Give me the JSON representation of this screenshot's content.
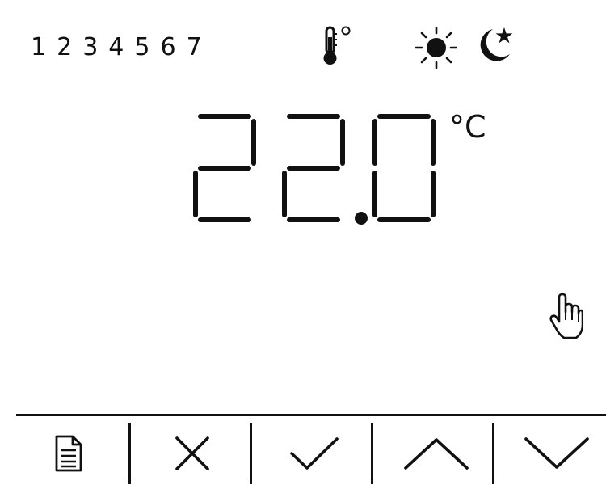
{
  "days": [
    "1",
    "2",
    "3",
    "4",
    "5",
    "6",
    "7"
  ],
  "status_icons": {
    "thermometer": "thermometer-icon",
    "day_mode": "sun-icon",
    "night_mode": "moon-star-icon"
  },
  "temperature": {
    "value": "22.0",
    "unit": "°C"
  },
  "pointer": "hand-pointer-icon",
  "toolbar": {
    "buttons": [
      {
        "icon": "document-icon",
        "name": "menu"
      },
      {
        "icon": "close-icon",
        "name": "cancel"
      },
      {
        "icon": "check-icon",
        "name": "confirm"
      },
      {
        "icon": "chevron-up-icon",
        "name": "up"
      },
      {
        "icon": "chevron-down-icon",
        "name": "down"
      }
    ]
  },
  "colors": {
    "foreground": "#111111",
    "background": "#ffffff"
  }
}
